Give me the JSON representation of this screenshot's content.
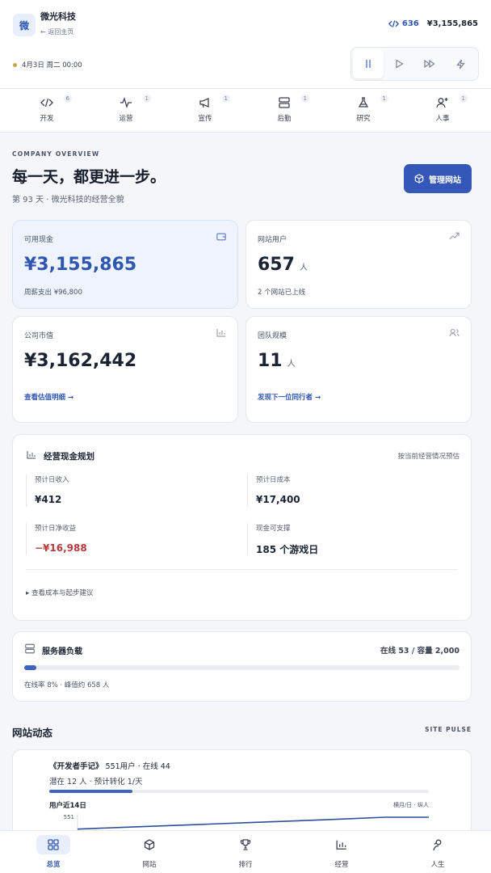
{
  "header": {
    "logo_char": "微",
    "company_name": "微光科技",
    "back_link": "← 返回主页",
    "code_points": "636",
    "cash": "¥3,155,865",
    "date": "4月3日 周二 00:00"
  },
  "departments": [
    {
      "label": "开发",
      "badge": "6",
      "icon": "code-icon"
    },
    {
      "label": "运营",
      "badge": "1",
      "icon": "pulse-icon"
    },
    {
      "label": "宣传",
      "badge": "1",
      "icon": "megaphone-icon"
    },
    {
      "label": "后勤",
      "badge": "1",
      "icon": "server-icon"
    },
    {
      "label": "研究",
      "badge": "1",
      "icon": "flask-icon"
    },
    {
      "label": "人事",
      "badge": "1",
      "icon": "user-plus-icon"
    }
  ],
  "overview": {
    "overline": "COMPANY OVERVIEW",
    "headline": "每一天，都更进一步。",
    "subline": "第 93 天 · 微光科技的经营全貌",
    "manage_button": "管理网站"
  },
  "stats": {
    "cash": {
      "label": "可用现金",
      "value": "¥3,155,865",
      "foot": "周薪支出 ¥96,800"
    },
    "users": {
      "label": "网站用户",
      "value": "657",
      "unit": "人",
      "foot": "2 个网站已上线"
    },
    "valuation": {
      "label": "公司市值",
      "value": "¥3,162,442",
      "link": "查看估值明细 →"
    },
    "team": {
      "label": "团队规模",
      "value": "11",
      "unit": "人",
      "link": "发现下一位同行者 →"
    }
  },
  "plan": {
    "title": "经营现金规划",
    "note": "按当前经营情况预估",
    "metrics": [
      {
        "label": "预计日收入",
        "value": "¥412"
      },
      {
        "label": "预计日成本",
        "value": "¥17,400"
      },
      {
        "label": "预计日净收益",
        "value": "−¥16,988"
      },
      {
        "label": "现金可支撑",
        "value": "185 个游戏日"
      }
    ],
    "more": "▸ 查看成本与起步建议"
  },
  "server": {
    "title": "服务器负载",
    "capacity": "在线 53 / 容量 2,000",
    "load_fraction": 0.027,
    "foot": "在线率 8% · 峰值约 658 人"
  },
  "pulse": {
    "title": "网站动态",
    "tag": "SITE PULSE",
    "site": {
      "name": "《开发者手记》",
      "stats": "551用户 · 在线 44",
      "meta": "潜在 12 人 · 预计转化 1/天",
      "conversion_fraction": 0.22,
      "chart_label": "用户近14日",
      "legend": "横月/日 · 纵人",
      "y_tick": "551"
    }
  },
  "chart_data": {
    "type": "line",
    "title": "用户近14日",
    "ylabel": "",
    "y_tick_labels": [
      "551"
    ],
    "series": [
      {
        "values": [
          480,
          490,
          500,
          510,
          520,
          530,
          540,
          551,
          551
        ]
      }
    ]
  },
  "nav": [
    {
      "label": "总览",
      "icon": "grid-icon",
      "active": true
    },
    {
      "label": "网站",
      "icon": "cube-icon",
      "active": false
    },
    {
      "label": "排行",
      "icon": "trophy-icon",
      "active": false
    },
    {
      "label": "经营",
      "icon": "bar-chart-icon",
      "active": false
    },
    {
      "label": "人生",
      "icon": "person-icon",
      "active": false
    }
  ]
}
